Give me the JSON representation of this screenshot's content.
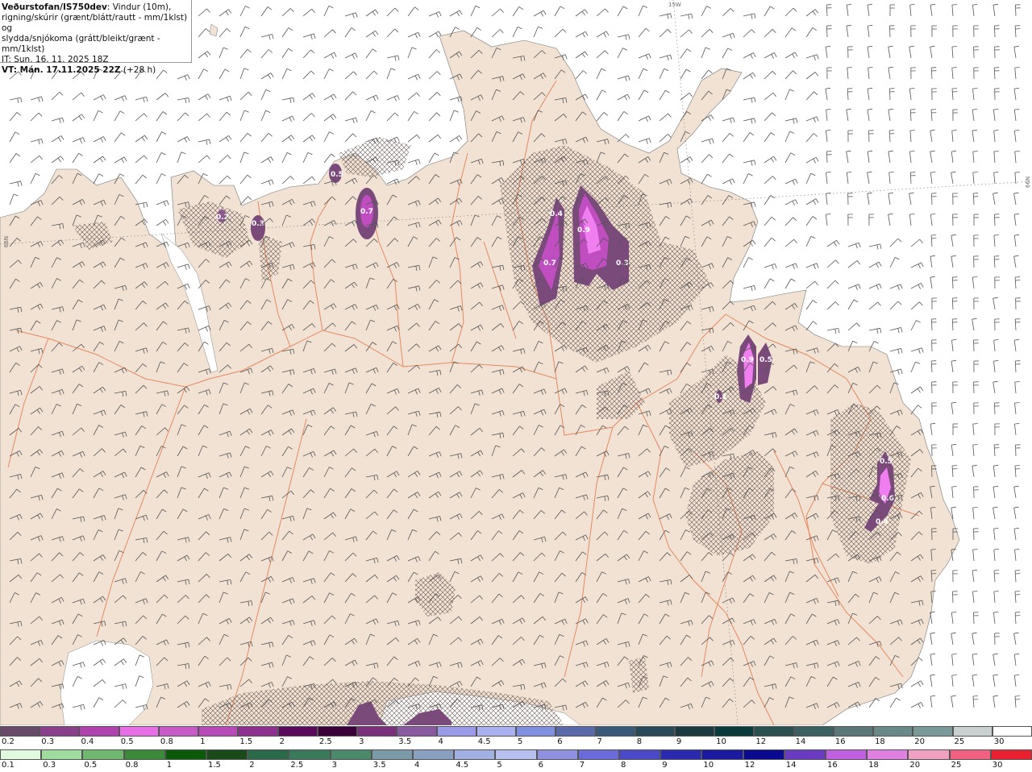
{
  "header": {
    "title": "Veðurstofan/IS750dev",
    "description_line1": ": Vindur (10m),",
    "description_line2": "rigning/skúrir (grænt/blátt/rautt - mm/1klst) og",
    "description_line3": "slydda/snjókoma (grátt/bleikt/grænt - mm/1klst)",
    "issue_time": "IT: Sun. 16. 11. 2025 18Z",
    "valid_time": "VT: Mán. 17.11.2025 22Z",
    "lead_time": "(+28 h)"
  },
  "coordinates": {
    "lon_label": "15W",
    "lat_label_left": "66N",
    "lat_label_right": "66N"
  },
  "precip_labels": [
    "0.5",
    "0.2",
    "0.3",
    "0.7",
    "0.4",
    "0.9",
    "0.7",
    "0.3",
    "0.9",
    "0.5",
    "0.1",
    "0.5",
    "0.6",
    "0.4"
  ],
  "colors": {
    "land": "#f1e2d4",
    "sea": "#ffffff",
    "roads": "#e8885e",
    "wind_barbs": "#555555",
    "snow_hatch": "#6b5a55",
    "precip_light": "#7a4a7a",
    "precip_medium": "#c04ec0",
    "precip_heavy": "#f07ef0"
  },
  "legend_top": {
    "ticks": [
      "0.2",
      "0.3",
      "0.4",
      "0.5",
      "0.8",
      "1",
      "1.5",
      "2",
      "2.5",
      "3",
      "3.5",
      "4",
      "4.5",
      "5",
      "6",
      "7",
      "8",
      "9",
      "10",
      "12",
      "14",
      "16",
      "18",
      "20",
      "25",
      "30"
    ],
    "colors": [
      "#6a4a6a",
      "#8a3f8a",
      "#b042b0",
      "#e86ee8",
      "#c85ac8",
      "#b84ab8",
      "#8f2f8f",
      "#5a0a5a",
      "#3a003a",
      "#7a307a",
      "#8a5aa0",
      "#9a9ae8",
      "#aab0f0",
      "#8090e0",
      "#5a6aa8",
      "#3a5a7a",
      "#2a4a5a",
      "#1a3a40",
      "#0a3a3a",
      "#2a5050",
      "#3a6060",
      "#5a7878",
      "#6a8a8a",
      "#7a9a9a",
      "#c8d0d0",
      "#ffffff"
    ]
  },
  "legend_bottom": {
    "ticks": [
      "0.1",
      "0.3",
      "0.5",
      "0.8",
      "1",
      "1.5",
      "2",
      "2.5",
      "3",
      "3.5",
      "4",
      "4.5",
      "5",
      "6",
      "7",
      "8",
      "9",
      "10",
      "12",
      "14",
      "16",
      "18",
      "20",
      "25",
      "30"
    ],
    "colors": [
      "#e0fae0",
      "#a0dca0",
      "#70b870",
      "#3a8a3a",
      "#0a5a0a",
      "#1a4a1a",
      "#2a6a4a",
      "#3a7a5a",
      "#4a8a6a",
      "#7a9aaa",
      "#8aa0c0",
      "#a0b0e0",
      "#b8c0f0",
      "#9090e0",
      "#6a6ad8",
      "#4a4ac8",
      "#2a2ab0",
      "#1a1aa0",
      "#0a0a90",
      "#6a3ac0",
      "#c060e0",
      "#e080e0",
      "#f0a0c0",
      "#f06080",
      "#e82030"
    ]
  }
}
